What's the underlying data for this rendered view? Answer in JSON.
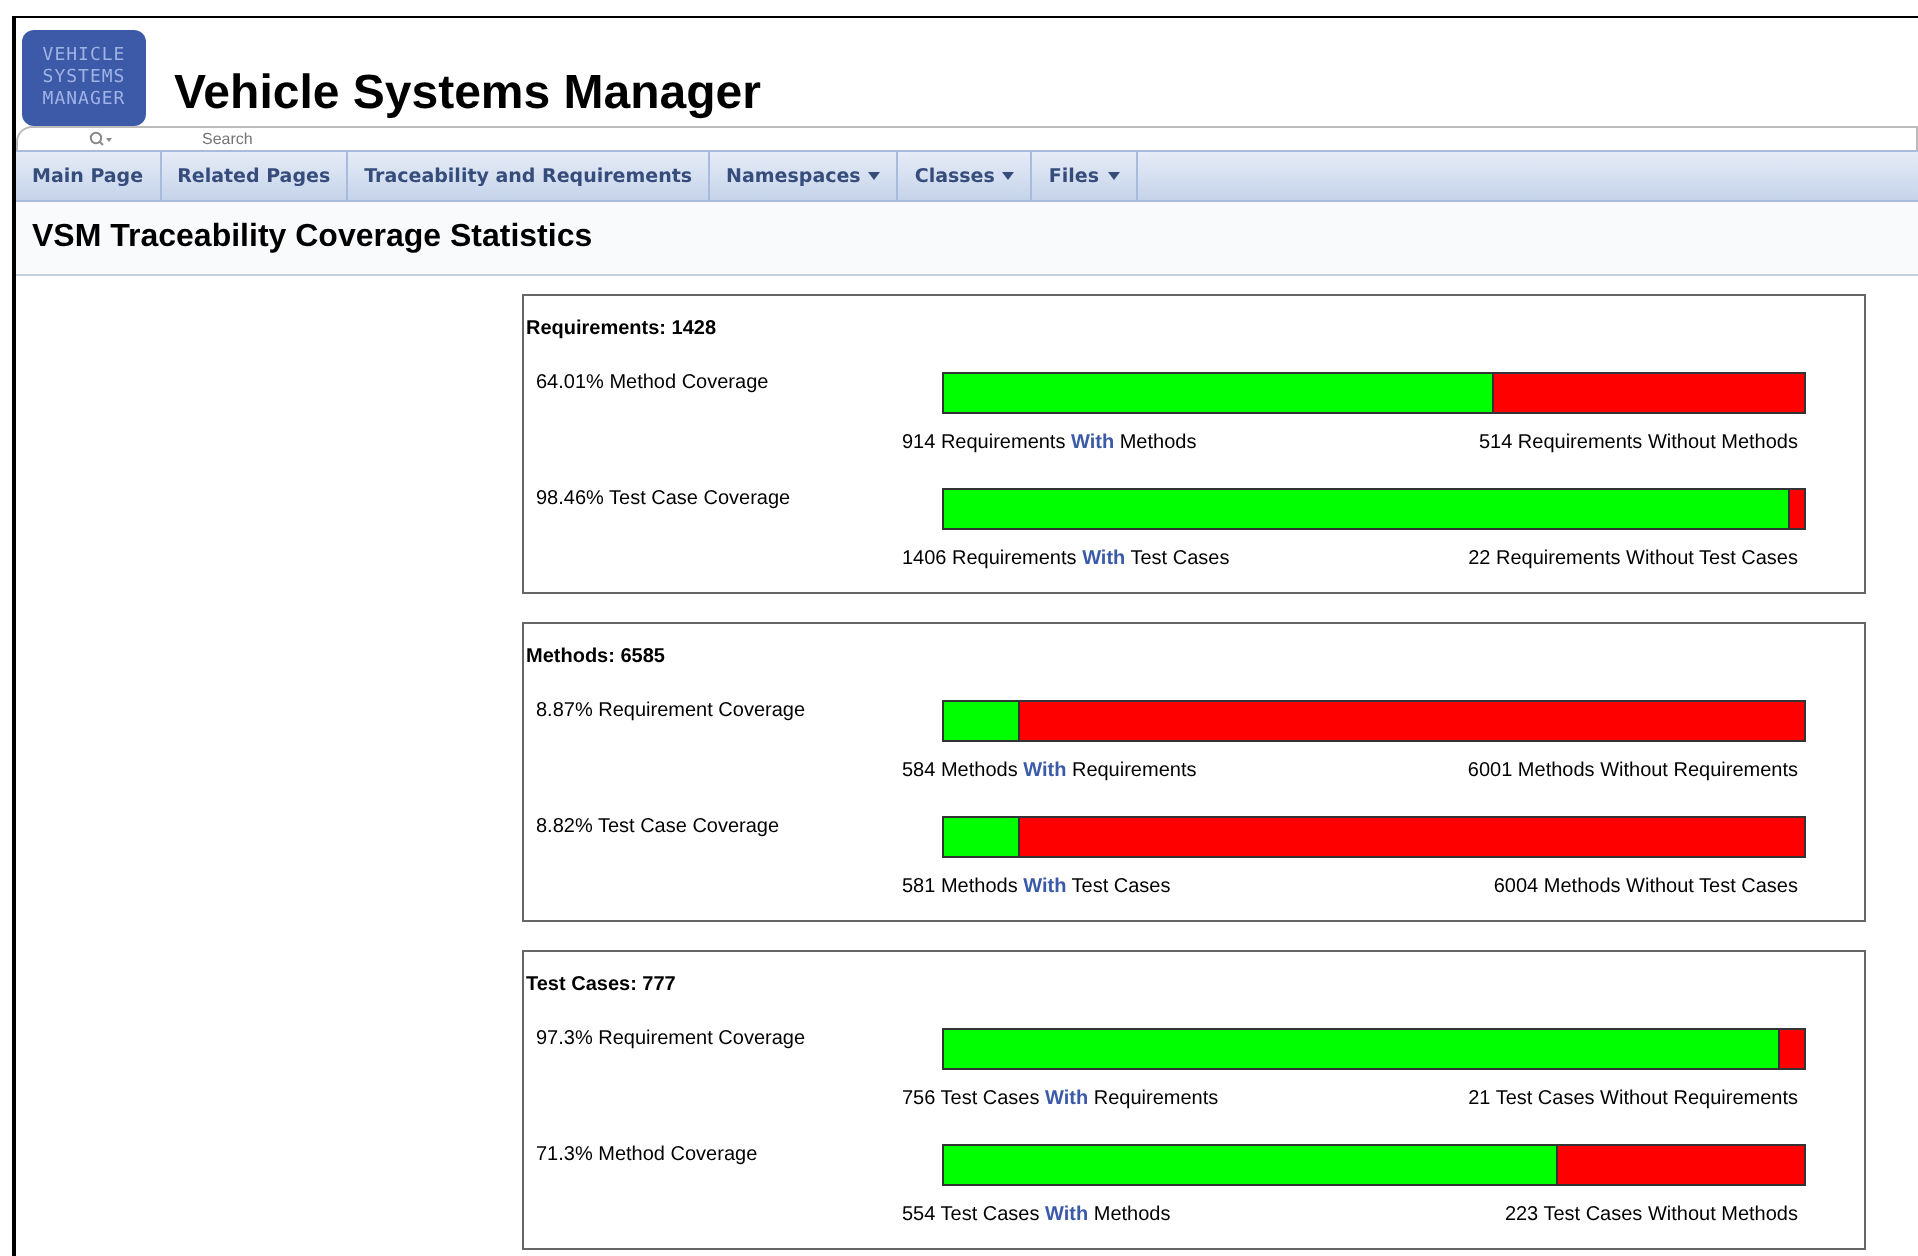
{
  "header": {
    "logo_lines": [
      "VEHICLE",
      "SYSTEMS",
      "MANAGER"
    ],
    "title": "Vehicle Systems Manager"
  },
  "search": {
    "placeholder": "Search"
  },
  "nav": [
    {
      "label": "Main Page",
      "dropdown": false
    },
    {
      "label": "Related Pages",
      "dropdown": false
    },
    {
      "label": "Traceability and Requirements",
      "dropdown": false
    },
    {
      "label": "Namespaces",
      "dropdown": true
    },
    {
      "label": "Classes",
      "dropdown": true
    },
    {
      "label": "Files",
      "dropdown": true
    }
  ],
  "page_title": "VSM Traceability Coverage Statistics",
  "sections": [
    {
      "title": "Requirements: 1428",
      "rows": [
        {
          "label": "64.01% Method Coverage",
          "level": 0.6401,
          "with_text": "914 Requirements **With** Methods",
          "without_text": "514 Requirements Without Methods"
        },
        {
          "label": "98.46% Test Case Coverage",
          "level": 0.9846,
          "with_text": "1406 Requirements **With** Test Cases",
          "without_text": "22 Requirements Without Test Cases"
        }
      ]
    },
    {
      "title": "Methods: 6585",
      "rows": [
        {
          "label": "8.87% Requirement Coverage",
          "level": 0.0887,
          "with_text": "584 Methods **With** Requirements",
          "without_text": "6001 Methods Without Requirements"
        },
        {
          "label": "8.82% Test Case Coverage",
          "level": 0.0882,
          "with_text": "581 Methods **With** Test Cases",
          "without_text": "6004 Methods Without Test Cases"
        }
      ]
    },
    {
      "title": "Test Cases: 777",
      "rows": [
        {
          "label": "97.3% Requirement Coverage",
          "level": 0.973,
          "with_text": "756 Test Cases **With** Requirements",
          "without_text": "21 Test Cases Without Requirements"
        },
        {
          "label": "71.3% Method Coverage",
          "level": 0.713,
          "with_text": "554 Test Cases **With** Methods",
          "without_text": "223 Test Cases Without Methods"
        }
      ]
    }
  ]
}
